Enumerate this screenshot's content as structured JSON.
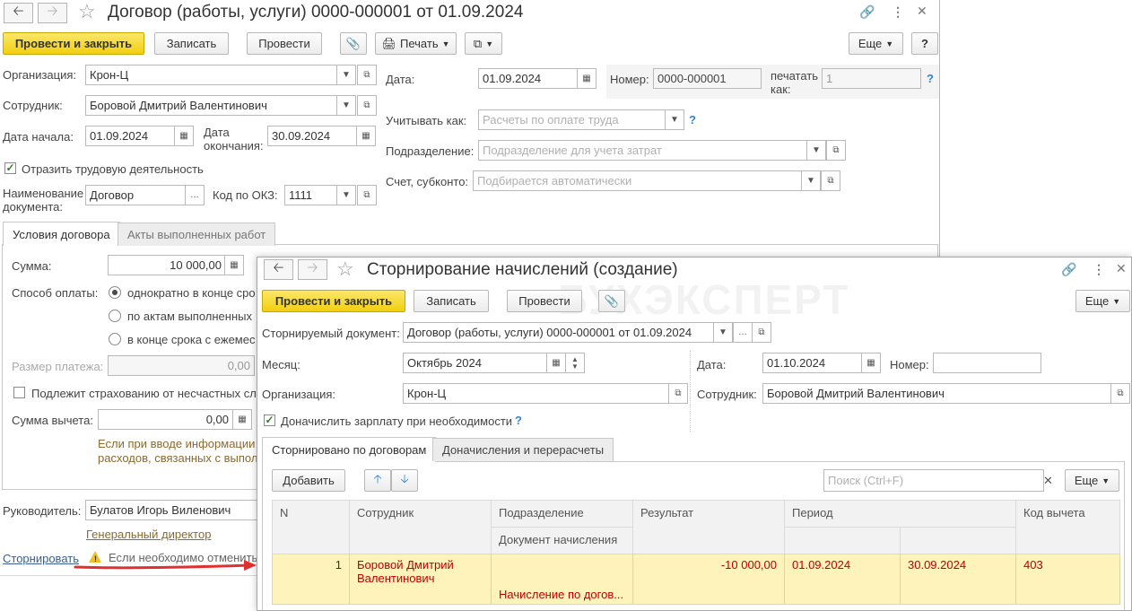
{
  "main": {
    "title": "Договор (работы, услуги) 0000-000001 от 01.09.2024",
    "toolbar": {
      "post_close": "Провести и закрыть",
      "save": "Записать",
      "post": "Провести",
      "print": "Печать",
      "more": "Еще",
      "help": "?"
    },
    "org_label": "Организация:",
    "org_value": "Крон-Ц",
    "emp_label": "Сотрудник:",
    "emp_value": "Боровой Дмитрий Валентинович",
    "start_label": "Дата начала:",
    "start_value": "01.09.2024",
    "end_label1": "Дата",
    "end_label2": "окончания:",
    "end_value": "30.09.2024",
    "work_activity": "Отразить трудовую деятельность",
    "docname_label1": "Наименование",
    "docname_label2": "документа:",
    "docname_value": "Договор",
    "okz_label": "Код по ОКЗ:",
    "okz_value": "1111",
    "date_label": "Дата:",
    "date_value": "01.09.2024",
    "number_label": "Номер:",
    "number_value": "0000-000001",
    "print_as_label1": "печатать",
    "print_as_label2": "как:",
    "print_as_value": "1",
    "account_as_label": "Учитывать как:",
    "account_as_placeholder": "Расчеты по оплате труда",
    "dept_label": "Подразделение:",
    "dept_placeholder": "Подразделение для учета затрат",
    "subconto_label": "Счет, субконто:",
    "subconto_placeholder": "Подбирается автоматически",
    "tabs": [
      "Условия договора",
      "Акты выполненных работ"
    ],
    "sum_label": "Сумма:",
    "sum_value": "10 000,00",
    "pay_method_label": "Способ оплаты:",
    "pay_options": [
      "однократно в конце сро",
      "по актам выполненных",
      "в конце срока с ежемес"
    ],
    "payment_size_label": "Размер платежа:",
    "payment_size_value": "0,00",
    "insurance": "Подлежит страхованию от несчастных сл",
    "deduction_label": "Сумма вычета:",
    "deduction_value": "0,00",
    "note_line1": "Если при вводе информации",
    "note_line2": "расходов, связанных с выпол",
    "manager_label": "Руководитель:",
    "manager_value": "Булатов Игорь Виленович",
    "manager_position": "Генеральный директор",
    "reverse_link": "Сторнировать",
    "reverse_note": "Если необходимо отменить"
  },
  "dialog": {
    "title": "Сторнирование начислений (создание)",
    "watermark": "БУХЭКСПЕРТ",
    "toolbar": {
      "post_close": "Провести и закрыть",
      "save": "Записать",
      "post": "Провести",
      "more": "Еще"
    },
    "doc_label": "Сторнируемый документ:",
    "doc_value": "Договор (работы, услуги) 0000-000001 от 01.09.2024",
    "month_label": "Месяц:",
    "month_value": "Октябрь 2024",
    "date_label": "Дата:",
    "date_value": "01.10.2024",
    "number_label": "Номер:",
    "number_value": "",
    "org_label": "Организация:",
    "org_value": "Крон-Ц",
    "emp_label": "Сотрудник:",
    "emp_value": "Боровой Дмитрий Валентинович",
    "extra_pay": "Доначислить зарплату при необходимости",
    "tabs": [
      "Сторнировано по договорам",
      "Доначисления и перерасчеты"
    ],
    "add": "Добавить",
    "search_placeholder": "Поиск (Ctrl+F)",
    "more": "Еще",
    "columns": {
      "n": "N",
      "employee": "Сотрудник",
      "dept": "Подразделение",
      "accrual_doc": "Документ начисления",
      "result": "Результат",
      "period": "Период",
      "code": "Код вычета"
    },
    "rows": [
      {
        "n": "1",
        "employee": "Боровой Дмитрий Валентинович",
        "dept": "",
        "accrual_doc": "Начисление по догов...",
        "result": "-10 000,00",
        "period_from": "01.09.2024",
        "period_to": "30.09.2024",
        "code": "403"
      }
    ]
  },
  "colors": {
    "accent_yellow": "#f2cf10",
    "row_highlight": "#fff3bc",
    "red_text": "#c00000",
    "arrow": "#e03030",
    "link": "#3c5e8a"
  }
}
